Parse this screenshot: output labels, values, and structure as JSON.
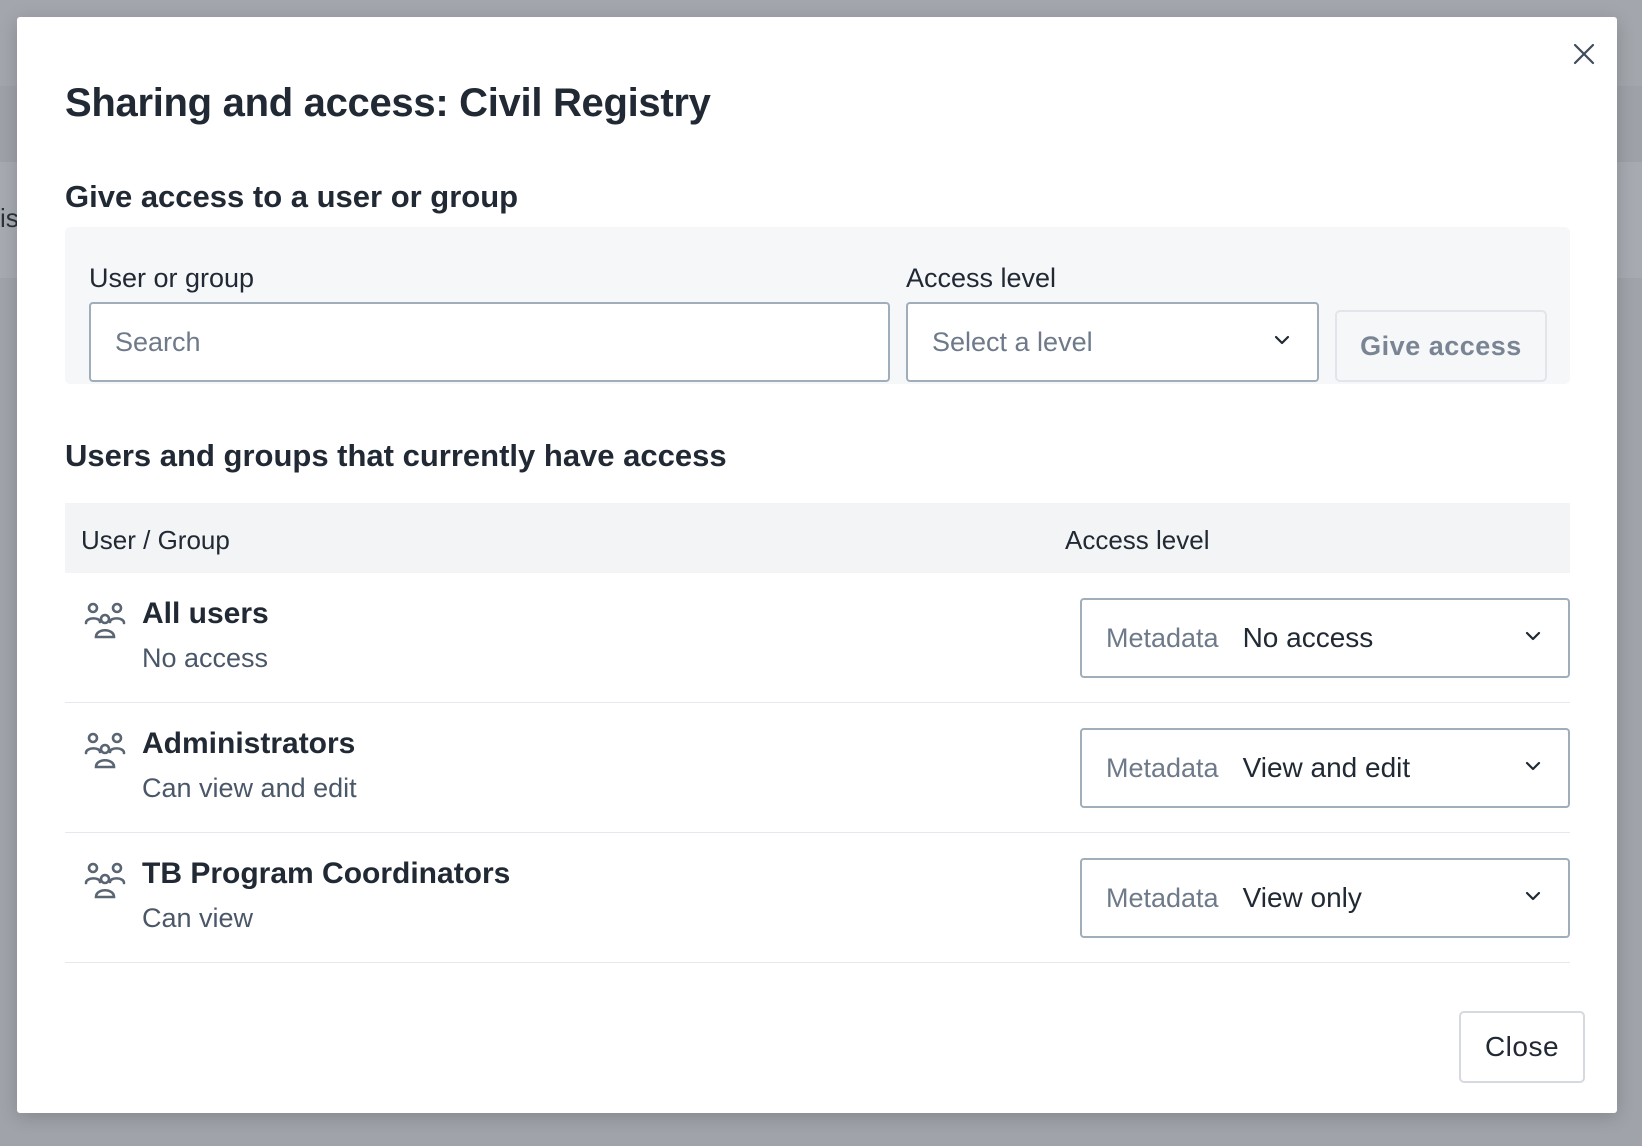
{
  "background": {
    "partial_text": "is"
  },
  "dialog": {
    "title": "Sharing and access: Civil Registry",
    "give_access": {
      "heading": "Give access to a user or group",
      "user_label": "User or group",
      "user_placeholder": "Search",
      "user_value": "",
      "level_label": "Access level",
      "level_placeholder": "Select a level",
      "submit_label": "Give access",
      "submit_enabled": false
    },
    "current_access": {
      "heading": "Users and groups that currently have access",
      "columns": [
        "User / Group",
        "Access level"
      ],
      "rows": [
        {
          "name": "All users",
          "description": "No access",
          "icon": "user-group-icon",
          "metadata_prefix": "Metadata",
          "metadata_value": "No access"
        },
        {
          "name": "Administrators",
          "description": "Can view and edit",
          "icon": "user-group-icon",
          "metadata_prefix": "Metadata",
          "metadata_value": "View and edit"
        },
        {
          "name": "TB Program Coordinators",
          "description": "Can view",
          "icon": "user-group-icon",
          "metadata_prefix": "Metadata",
          "metadata_value": "View only"
        }
      ]
    },
    "close_label": "Close",
    "close_icon": "close-icon"
  },
  "colors": {
    "overlay": "#a0a4aa",
    "text": "#212934",
    "muted_text": "#6e7a8a",
    "border": "#a0adba",
    "panel": "#f6f7f9"
  }
}
